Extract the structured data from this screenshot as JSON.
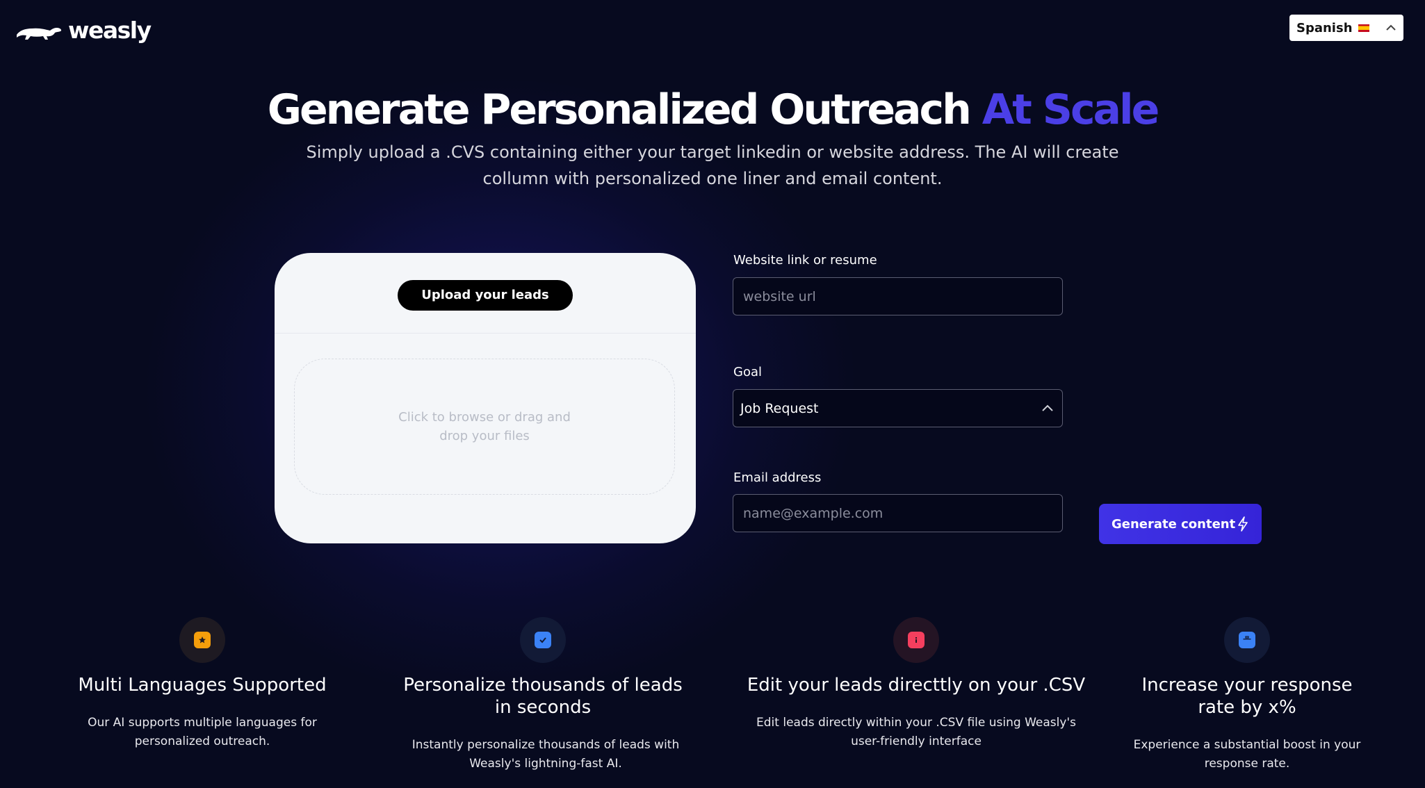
{
  "header": {
    "logo_text": "weasly",
    "language": {
      "selected": "Spanish",
      "flag_icon": "spain-flag-icon"
    }
  },
  "hero": {
    "title_main": "Generate Personalized Outreach",
    "title_accent": "At Scale",
    "subtitle": "Simply upload a .CVS containing either your target linkedin or website address. The AI will create collumn with personalized one liner and email content."
  },
  "upload": {
    "button_label": "Upload your leads",
    "dropzone_text": "Click to browse or drag and drop your files"
  },
  "form": {
    "website": {
      "label": "Website link or resume",
      "placeholder": "website url",
      "value": ""
    },
    "goal": {
      "label": "Goal",
      "selected": "Job Request"
    },
    "email": {
      "label": "Email address",
      "placeholder": "name@example.com",
      "value": ""
    },
    "generate_button": "Generate content"
  },
  "features": [
    {
      "icon": "ticket-star-icon",
      "icon_color": "#f59e0b",
      "title": "Multi Languages Supported",
      "description": "Our AI supports multiple languages for personalized outreach."
    },
    {
      "icon": "checkbox-icon",
      "icon_color": "#3b82f6",
      "title": "Personalize thousands of leads in seconds",
      "description": "Instantly personalize thousands of leads with Weasly's lightning-fast AI."
    },
    {
      "icon": "info-icon",
      "icon_color": "#f43f5e",
      "title": "Edit your leads directtly on your .CSV",
      "description": "Edit leads directly within your .CSV file using Weasly's user-friendly interface"
    },
    {
      "icon": "briefcase-icon",
      "icon_color": "#3b82f6",
      "title": "Increase your response rate by x%",
      "description": "Experience a substantial boost in your response rate."
    }
  ],
  "colors": {
    "background": "#070a1f",
    "accent": "#4b3fe6",
    "button_primary": "#3a2ce0"
  }
}
